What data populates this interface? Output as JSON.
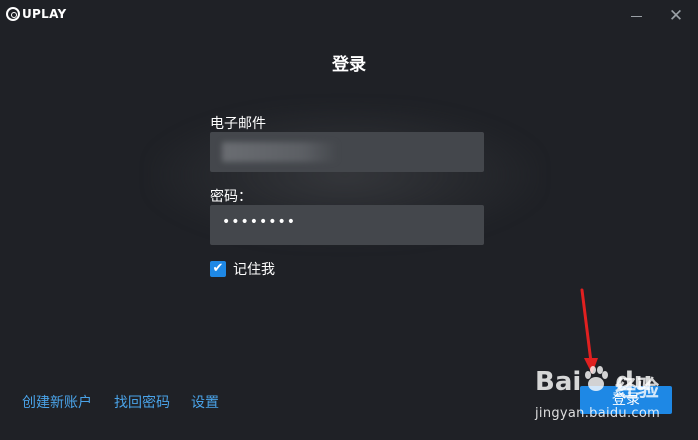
{
  "titlebar": {
    "app_name": "UPLAY",
    "minimize_icon": "minimize-icon",
    "close_icon": "close-icon",
    "close_glyph": "✕"
  },
  "login_form": {
    "title": "登录",
    "email_label": "电子邮件",
    "password_label": "密码：",
    "password_value": "••••••••",
    "remember_label": "记住我",
    "remember_checked": true
  },
  "footer": {
    "links": [
      "创建新账户",
      "找回密码",
      "设置"
    ],
    "login_button": "登录"
  },
  "watermark": {
    "brand_latin": "Bai",
    "brand_latin_2": "du",
    "brand_cn": "经验",
    "url": "jingyan.baidu.com"
  },
  "colors": {
    "background": "#1f2126",
    "input_background": "#44474c",
    "accent": "#1e88e5",
    "link": "#4aa3e8",
    "annotation_arrow": "#e02020"
  }
}
